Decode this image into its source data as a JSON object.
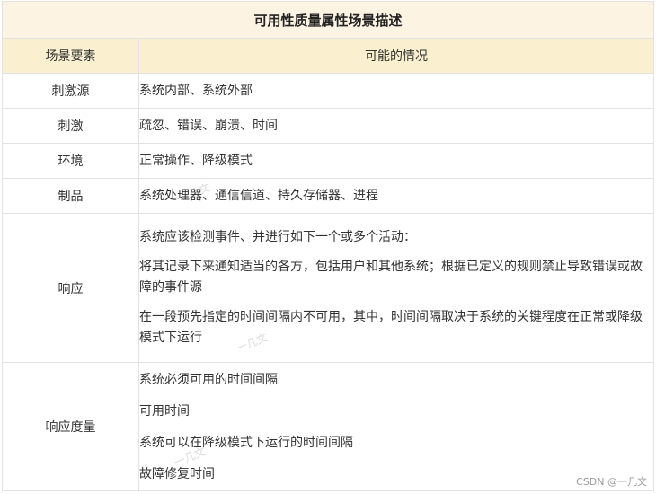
{
  "table": {
    "title": "可用性质量属性场景描述",
    "headers": {
      "element": "场景要素",
      "situation": "可能的情况"
    },
    "rows": [
      {
        "element": "刺激源",
        "situation": "系统内部、系统外部"
      },
      {
        "element": "刺激",
        "situation": "疏忽、错误、崩溃、时间"
      },
      {
        "element": "环境",
        "situation": "正常操作、降级模式"
      },
      {
        "element": "制品",
        "situation": "系统处理器、通信信道、持久存储器、进程"
      }
    ],
    "response": {
      "element": "响应",
      "paragraphs": [
        "系统应该检测事件、并进行如下一个或多个活动：",
        "将其记录下来通知适当的各方，包括用户和其他系统；根据已定义的规则禁止导致错误或故障的事件源",
        "在一段预先指定的时间间隔内不可用，其中，时间间隔取决于系统的关键程度在正常或降级模式下运行"
      ]
    },
    "measure": {
      "element": "响应度量",
      "paragraphs": [
        "系统必须可用的时间间隔",
        "可用时间",
        "系统可以在降级模式下运行的时间间隔",
        "故障修复时间"
      ]
    }
  },
  "watermark": {
    "faint_text": "一几文",
    "credit": "CSDN @一几文"
  }
}
